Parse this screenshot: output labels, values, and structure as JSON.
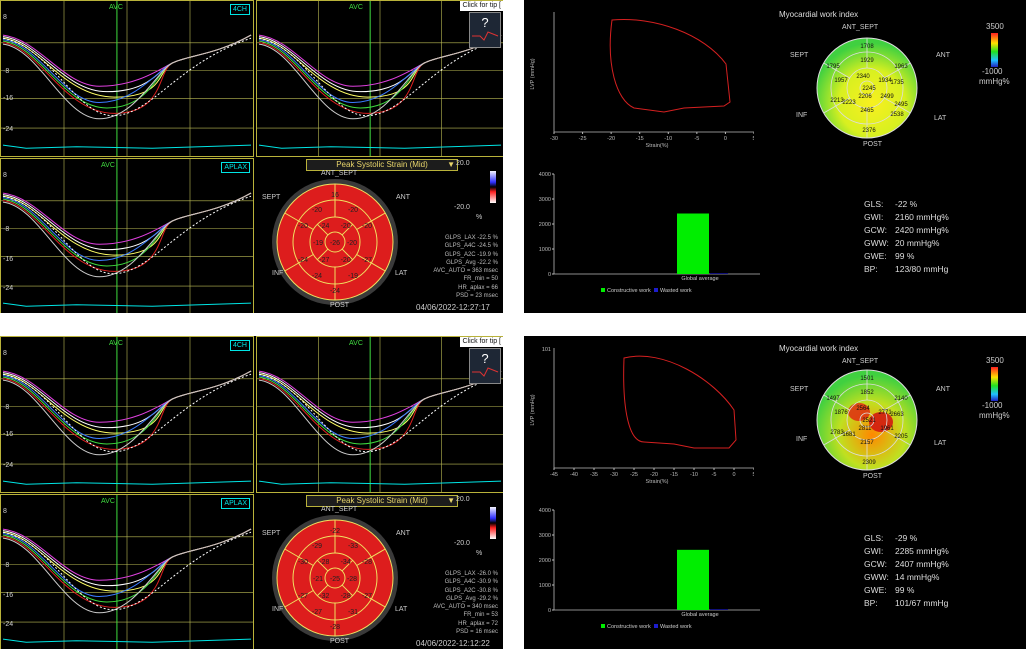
{
  "colors": {
    "panel": "#000000",
    "frame": "#b9b23a",
    "cyan": "#00e5e5",
    "green": "#3fdc3f",
    "segment_red": "#dd1d1d",
    "pv_loop": "#d52020",
    "bar": "#00ee00",
    "wasted": "#1d1dcc"
  },
  "top": {
    "strain": {
      "view_4ch": "4CH",
      "view_aplax": "APLAX",
      "avc": "AVC",
      "yticks": [
        "8",
        "-8",
        "-16",
        "-24"
      ],
      "click_hint": "Click for tip [",
      "help": "?",
      "mode": "Peak Systolic Strain (Mid)",
      "scale_max": "20.0",
      "scale_min": "-20.0",
      "scale_unit": "%",
      "bullseye_values": [
        [
          "16"
        ],
        [
          "-20",
          "-20"
        ],
        [
          "-20",
          "-24",
          "-20",
          "-20"
        ],
        [
          "-19",
          "-26",
          "-20"
        ],
        [
          "-24",
          "-27",
          "-20",
          "-27"
        ],
        [
          "-24",
          "-19"
        ],
        [
          "-24"
        ]
      ],
      "labels": {
        "top": "ANT_SEPT",
        "tl": "SEPT",
        "tr": "ANT",
        "bl": "INF",
        "br": "LAT",
        "bottom": "POST"
      },
      "stats": [
        "GLPS_LAX -22.5 %",
        "GLPS_A4C -24.5 %",
        "GLPS_A2C -19.9 %",
        "GLPS_Avg -22.2 %",
        "AVC_AUTO = 363 msec",
        "FR_min = 50",
        "HR_aplax = 66",
        "PSD = 23 msec"
      ],
      "date": "04/06/2022-12:27:17"
    },
    "work": {
      "title": "Myocardial work index",
      "pv": {
        "ylabel": "LVP (mmHg)",
        "xlabel": "Strain(%)",
        "xticks": [
          "-30",
          "-25",
          "-20",
          "-15",
          "-10",
          "-5",
          "0",
          "5"
        ]
      },
      "bar": {
        "yticks": [
          "4000",
          "3000",
          "2000",
          "1000",
          "0"
        ],
        "xlabel": "Global average",
        "legend": [
          "Constructive work",
          "Wasted work"
        ],
        "value": 2420,
        "wasted": 20,
        "ymax": 4000
      },
      "scale_max": "3500",
      "scale_min": "-1000",
      "scale_unit": "mmHg%",
      "bullseye_values": [
        "1708",
        "1795",
        "1929",
        "1963",
        "1957",
        "2340",
        "1934",
        "1735",
        "2245",
        "2206",
        "2499",
        "2213",
        "2223",
        "2495",
        "2465",
        "2376",
        "2538"
      ],
      "labels": {
        "top": "ANT_SEPT",
        "tl": "SEPT",
        "tr": "ANT",
        "bl": "INF",
        "br": "LAT",
        "bottom": "POST"
      },
      "stats": [
        {
          "k": "GLS:",
          "v": "-22 %"
        },
        {
          "k": "GWI:",
          "v": "2160 mmHg%"
        },
        {
          "k": "GCW:",
          "v": "2420 mmHg%"
        },
        {
          "k": "GWW:",
          "v": "20 mmHg%"
        },
        {
          "k": "GWE:",
          "v": "99 %"
        },
        {
          "k": "BP:",
          "v": "123/80 mmHg"
        }
      ]
    }
  },
  "bottom": {
    "strain": {
      "view_4ch": "4CH",
      "view_aplax": "APLAX",
      "avc": "AVC",
      "yticks": [
        "8",
        "-8",
        "-16",
        "-24"
      ],
      "click_hint": "Click for tip [",
      "help": "?",
      "mode": "Peak Systolic Strain (Mid)",
      "scale_max": "20.0",
      "scale_min": "-20.0",
      "scale_unit": "%",
      "bullseye_values": [
        [
          "-22"
        ],
        [
          "-29",
          "-33"
        ],
        [
          "-30",
          "-28",
          "-34",
          "-28"
        ],
        [
          "-21",
          "-25",
          "-28"
        ],
        [
          "-27",
          "-32",
          "-28",
          "-27"
        ],
        [
          "-27",
          "-31"
        ],
        [
          "-28"
        ]
      ],
      "labels": {
        "top": "ANT_SEPT",
        "tl": "SEPT",
        "tr": "ANT",
        "bl": "INF",
        "br": "LAT",
        "bottom": "POST"
      },
      "stats": [
        "GLPS_LAX -26.0 %",
        "GLPS_A4C -30.9 %",
        "GLPS_A2C -30.8 %",
        "GLPS_Avg -29.2 %",
        "AVC_AUTO = 340 msec",
        "FR_min = 53",
        "HR_aplax = 72",
        "PSD = 16 msec"
      ],
      "date": "04/06/2022-12:12:22"
    },
    "work": {
      "title": "Myocardial work index",
      "pv": {
        "ylabel": "LVP (mmHg)",
        "y_top": "101",
        "xlabel": "Strain(%)",
        "xticks": [
          "-45",
          "-40",
          "-35",
          "-30",
          "-25",
          "-20",
          "-15",
          "-10",
          "-5",
          "0",
          "5"
        ]
      },
      "bar": {
        "yticks": [
          "4000",
          "3000",
          "2000",
          "1000",
          "0"
        ],
        "xlabel": "Global average",
        "legend": [
          "Constructive work",
          "Wasted work"
        ],
        "value": 2407,
        "wasted": 14,
        "ymax": 4000
      },
      "scale_max": "3500",
      "scale_min": "-1000",
      "scale_unit": "mmHg%",
      "bullseye_values": [
        "1501",
        "1497",
        "1852",
        "2140",
        "1876",
        "2564",
        "2771",
        "2663",
        "2521",
        "2811",
        "1961",
        "2783",
        "1681",
        "2205",
        "2157",
        "2309"
      ],
      "labels": {
        "top": "ANT_SEPT",
        "tl": "SEPT",
        "tr": "ANT",
        "bl": "INF",
        "br": "LAT",
        "bottom": "POST"
      },
      "stats": [
        {
          "k": "GLS:",
          "v": "-29 %"
        },
        {
          "k": "GWI:",
          "v": "2285 mmHg%"
        },
        {
          "k": "GCW:",
          "v": "2407 mmHg%"
        },
        {
          "k": "GWW:",
          "v": "14 mmHg%"
        },
        {
          "k": "GWE:",
          "v": "99 %"
        },
        {
          "k": "BP:",
          "v": "101/67 mmHg"
        }
      ]
    }
  }
}
